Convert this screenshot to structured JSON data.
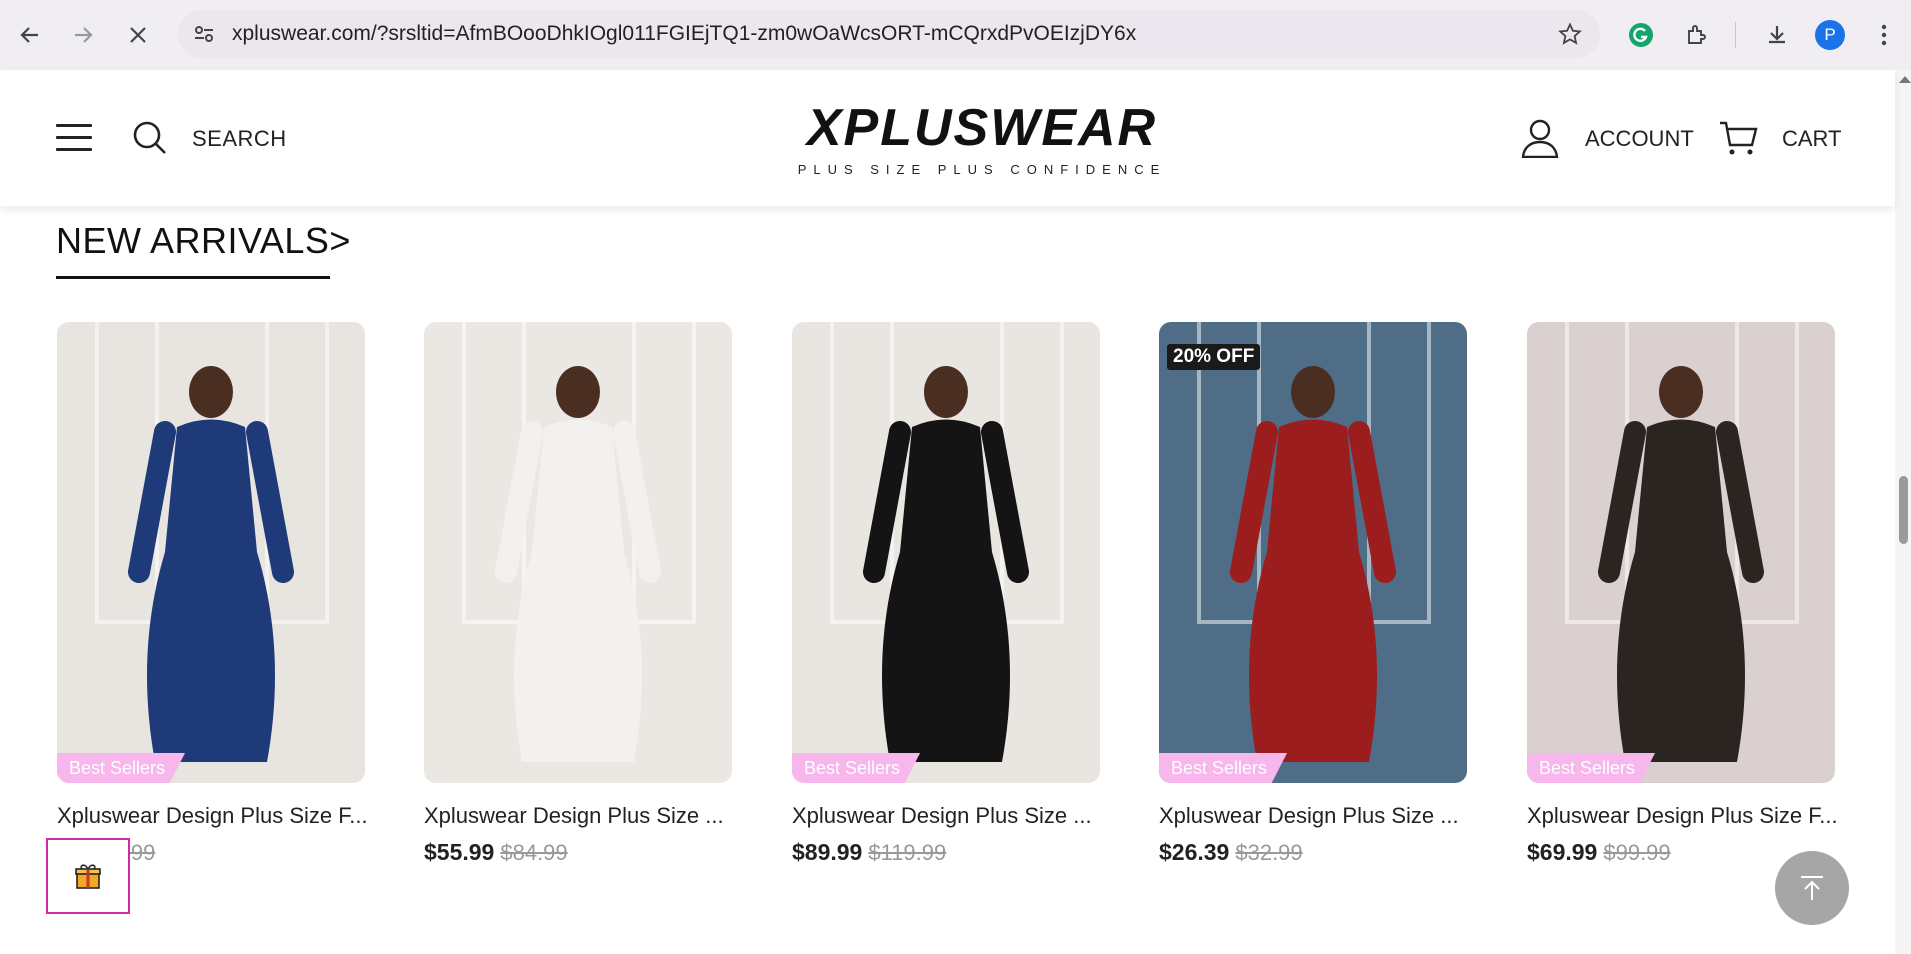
{
  "browser": {
    "url": "xpluswear.com/?srsltid=AfmBOooDhkIOgl011FGIEjTQ1-zm0wOaWcsORT-mCQrxdPvOEIzjDY6x",
    "profile_initial": "P",
    "icons": [
      "back-icon",
      "forward-icon",
      "stop-icon",
      "site-info-icon",
      "star-icon",
      "grammarly-icon",
      "extensions-icon",
      "download-icon",
      "menu-icon"
    ]
  },
  "header": {
    "search_label": "SEARCH",
    "logo_text": "XPLUSWEAR",
    "logo_tagline": "PLUS SIZE PLUS CONFIDENCE",
    "account_label": "ACCOUNT",
    "cart_label": "CART"
  },
  "section": {
    "title": "NEW ARRIVALS>"
  },
  "products": [
    {
      "title": "Xpluswear Design Plus Size F...",
      "price": "$",
      "old_price": "$109.99",
      "badge": "Best Sellers",
      "promo": "",
      "colors": {
        "bg": "#e8e4df",
        "dress": "#1e3a78"
      }
    },
    {
      "title": "Xpluswear Design Plus Size ...",
      "price": "$55.99",
      "old_price": "$84.99",
      "badge": "",
      "promo": "",
      "colors": {
        "bg": "#ebe8e4",
        "dress": "#f3f1ee"
      }
    },
    {
      "title": "Xpluswear Design Plus Size ...",
      "price": "$89.99",
      "old_price": "$119.99",
      "badge": "Best Sellers",
      "promo": "",
      "colors": {
        "bg": "#e9e6e2",
        "dress": "#141414"
      }
    },
    {
      "title": "Xpluswear Design Plus Size ...",
      "price": "$26.39",
      "old_price": "$32.99",
      "badge": "Best Sellers",
      "promo": "20% OFF",
      "colors": {
        "bg": "#4f6d86",
        "dress": "#9b1d1d"
      }
    },
    {
      "title": "Xpluswear Design Plus Size F...",
      "price": "$69.99",
      "old_price": "$99.99",
      "badge": "Best Sellers",
      "promo": "",
      "colors": {
        "bg": "#d9d0cf",
        "dress": "#2a2520"
      }
    }
  ]
}
